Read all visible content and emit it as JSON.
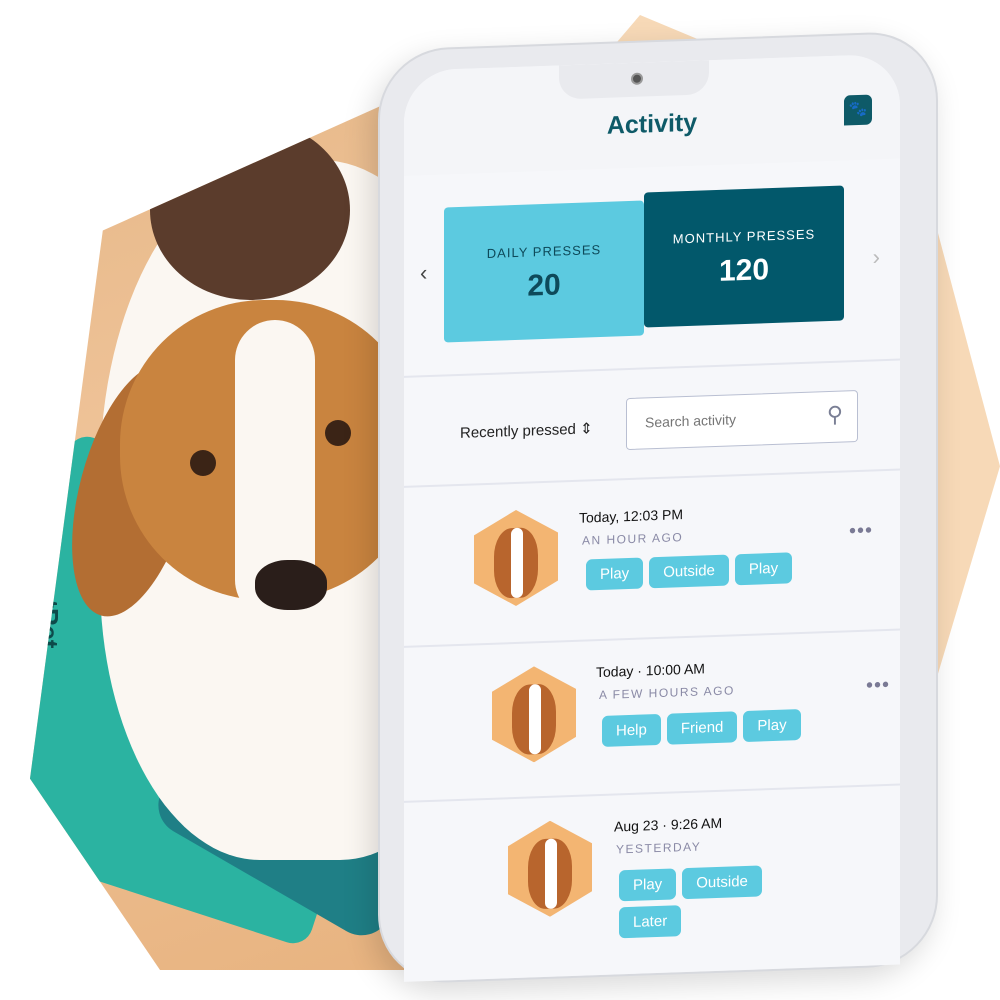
{
  "brand": {
    "mat_logo": "FluentPet",
    "accent": "#5ccae0",
    "dark": "#02586b",
    "peach": "#f7d9b7"
  },
  "header": {
    "title": "Activity",
    "icon": "paw-chat-icon"
  },
  "stats": {
    "prev_icon": "chevron-left-icon",
    "next_icon": "chevron-right-icon",
    "daily": {
      "label": "DAILY PRESSES",
      "value": "20"
    },
    "monthly": {
      "label": "MONTHLY PRESSES",
      "value": "120"
    }
  },
  "filter": {
    "sort_label": "Recently pressed",
    "sort_icon": "sort-updown-icon",
    "search_placeholder": "Search activity",
    "search_icon": "search-icon"
  },
  "activity": [
    {
      "time": "Today, 12:03 PM",
      "ago": "AN HOUR AGO",
      "tags": [
        "Play",
        "Outside",
        "Play"
      ]
    },
    {
      "time": "Today · 10:00 AM",
      "ago": "A FEW HOURS AGO",
      "tags": [
        "Help",
        "Friend",
        "Play"
      ]
    },
    {
      "time": "Aug 23 · 9:26 AM",
      "ago": "YESTERDAY",
      "tags": [
        "Play",
        "Outside",
        "Later"
      ]
    }
  ],
  "more_label": "•••"
}
